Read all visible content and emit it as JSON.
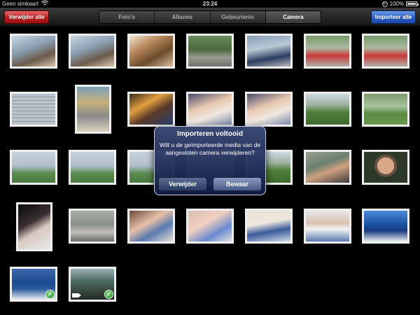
{
  "status_bar": {
    "carrier": "Geen simkaart",
    "time": "23:24",
    "battery": "100%",
    "icons": [
      "wifi-icon",
      "rotation-lock-icon",
      "battery-icon"
    ]
  },
  "toolbar": {
    "delete_all_label": "Verwijder alle",
    "import_all_label": "Importeer alle",
    "tabs": [
      {
        "label": "Foto's",
        "active": false
      },
      {
        "label": "Albums",
        "active": false
      },
      {
        "label": "Gebeurtenis",
        "active": false
      },
      {
        "label": "Camera",
        "active": true
      }
    ],
    "colors": {
      "delete": "#b51d1d",
      "import": "#2a5cc4"
    }
  },
  "alert": {
    "title": "Importeren voltooid",
    "message": "Wilt u de geïmporteerde media van de aangesloten camera verwijderen?",
    "delete_label": "Verwijder",
    "keep_label": "Bewaar"
  },
  "thumbnails": [
    {
      "imported": false,
      "video": false
    },
    {
      "imported": false,
      "video": false
    },
    {
      "imported": false,
      "video": false
    },
    {
      "imported": false,
      "video": false
    },
    {
      "imported": false,
      "video": false
    },
    {
      "imported": false,
      "video": false
    },
    {
      "imported": false,
      "video": false
    },
    {
      "imported": false,
      "video": false
    },
    {
      "imported": false,
      "video": false
    },
    {
      "imported": false,
      "video": false
    },
    {
      "imported": false,
      "video": false
    },
    {
      "imported": false,
      "video": false
    },
    {
      "imported": false,
      "video": false
    },
    {
      "imported": false,
      "video": false
    },
    {
      "imported": false,
      "video": false
    },
    {
      "imported": false,
      "video": false
    },
    {
      "imported": false,
      "video": false
    },
    {
      "imported": false,
      "video": false
    },
    {
      "imported": false,
      "video": false
    },
    {
      "imported": false,
      "video": false
    },
    {
      "imported": false,
      "video": false
    },
    {
      "imported": false,
      "video": false
    },
    {
      "imported": false,
      "video": false
    },
    {
      "imported": false,
      "video": false
    },
    {
      "imported": false,
      "video": false
    },
    {
      "imported": false,
      "video": false
    },
    {
      "imported": false,
      "video": false
    },
    {
      "imported": false,
      "video": false
    },
    {
      "imported": true,
      "video": false
    },
    {
      "imported": true,
      "video": true
    }
  ]
}
